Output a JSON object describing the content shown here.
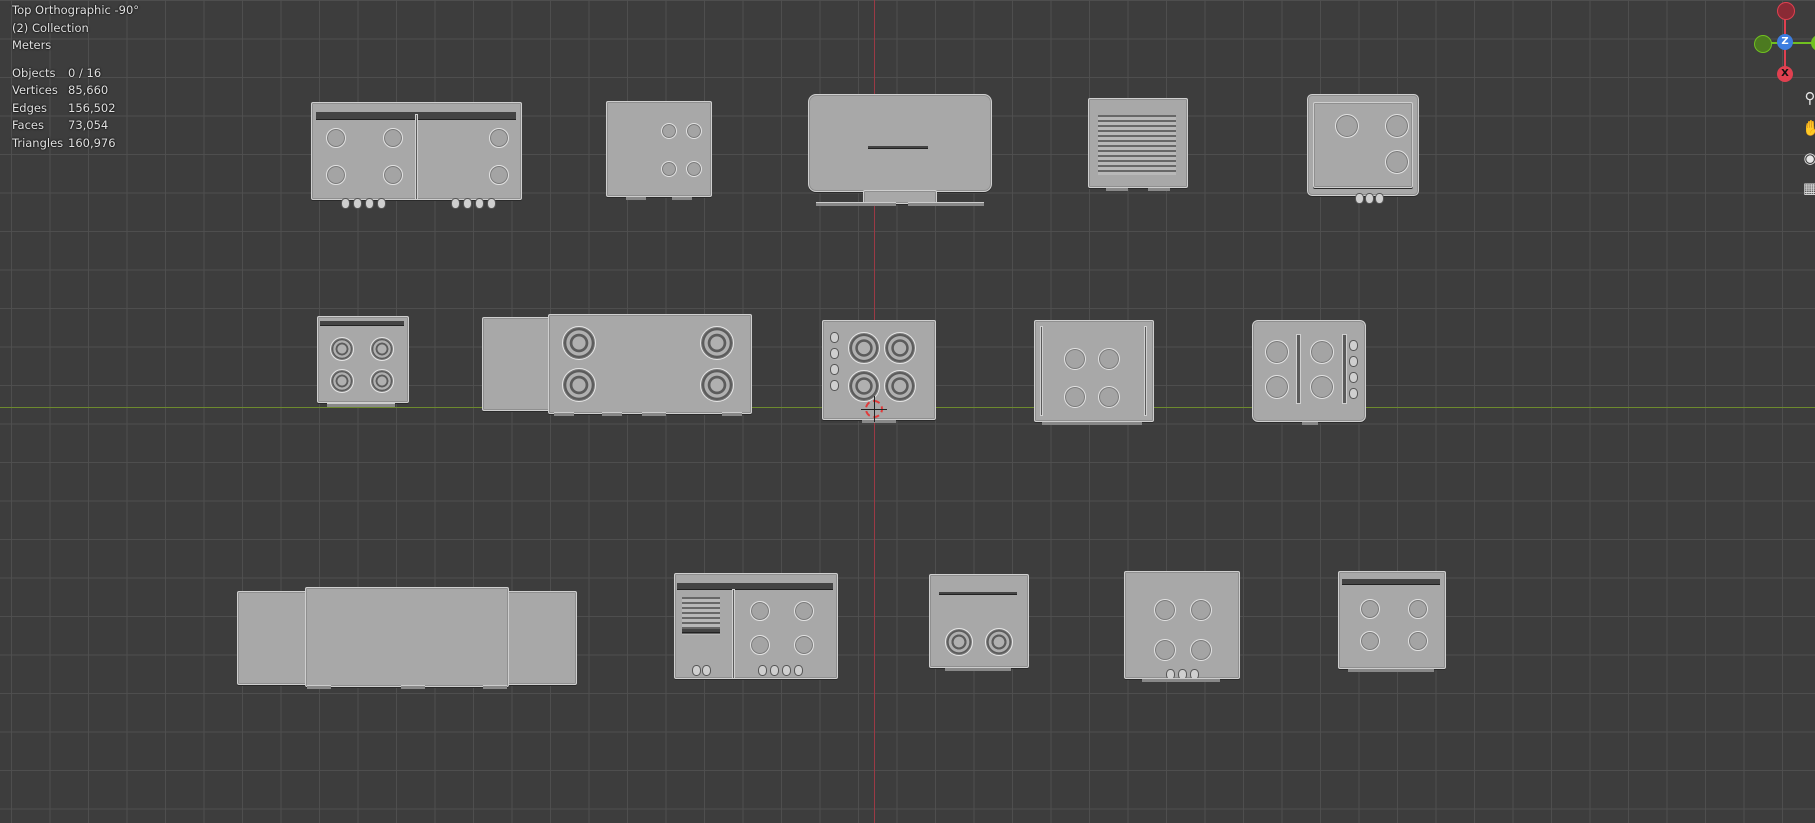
{
  "viewport": {
    "view_name": "Top Orthographic -90°",
    "collection": "(2) Collection",
    "units": "Meters",
    "stats": [
      {
        "label": "Objects",
        "value": "0 / 16"
      },
      {
        "label": "Vertices",
        "value": "85,660"
      },
      {
        "label": "Edges",
        "value": "156,502"
      },
      {
        "label": "Faces",
        "value": "73,054"
      },
      {
        "label": "Triangles",
        "value": "160,976"
      }
    ]
  },
  "gizmo": {
    "z_label": "Z",
    "x_label": "X",
    "colors": {
      "x": "#e04050",
      "y": "#70c020",
      "z": "#3d7ee0"
    }
  },
  "tools": [
    "zoom-icon",
    "pan-icon",
    "camera-icon",
    "grid-icon"
  ],
  "colors": {
    "background": "#3d3d3d",
    "grid": "#505050",
    "x_axis": "#6d8a2e",
    "y_axis": "#9b3a45",
    "mesh": "#a8a8a8"
  }
}
